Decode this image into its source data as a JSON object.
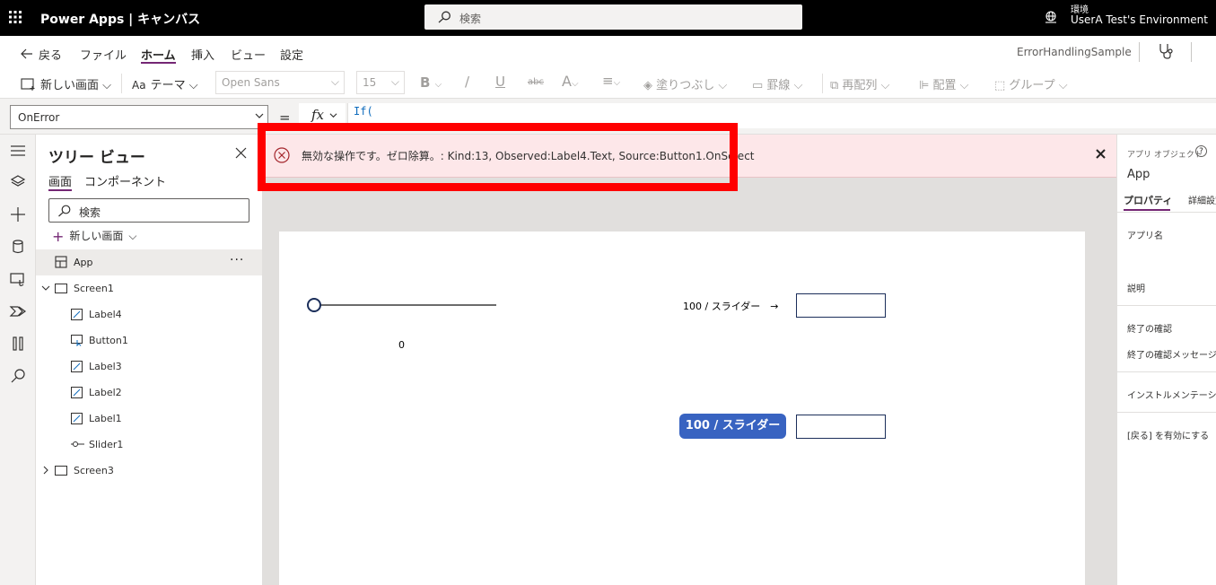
{
  "header": {
    "app_title": "Power Apps | キャンバス",
    "search_placeholder": "検索",
    "env_label": "環境",
    "env_name": "UserA Test's Environment"
  },
  "menu": {
    "back": "戻る",
    "file": "ファイル",
    "home": "ホーム",
    "insert": "挿入",
    "view": "ビュー",
    "settings": "設定",
    "app_name": "ErrorHandlingSample"
  },
  "toolbar": {
    "new_screen": "新しい画面",
    "theme": "テーマ",
    "font": "Open Sans",
    "font_size": "15",
    "bold": "B",
    "italic": "/",
    "underline": "U",
    "strike": "abc",
    "font_color": "A",
    "fill": "塗りつぶし",
    "border": "罫線",
    "reorder": "再配列",
    "align": "配置",
    "group": "グループ"
  },
  "formula": {
    "property": "OnError",
    "equals": "=",
    "fx": "fx",
    "text": "If("
  },
  "tree": {
    "title": "ツリー ビュー",
    "tab_screens": "画面",
    "tab_components": "コンポーネント",
    "search_placeholder": "検索",
    "new_screen": "新しい画面",
    "app": "App",
    "app_more": "···",
    "screen1": "Screen1",
    "children": [
      "Label4",
      "Button1",
      "Label3",
      "Label2",
      "Label1",
      "Slider1"
    ],
    "screen3": "Screen3"
  },
  "error": {
    "message": "無効な操作です。ゼロ除算。: Kind:13, Observed:Label4.Text, Source:Button1.OnSelect",
    "close": "×"
  },
  "canvas": {
    "slider_value": "0",
    "slider_level": 0,
    "label_top": "100 / スライダー　→",
    "button_text": "100 / スライダー"
  },
  "right_panel": {
    "header": "アプリ オブジェクト",
    "help": "?",
    "object_name": "App",
    "tab_properties": "プロパティ",
    "tab_advanced": "詳細設定",
    "app_name_label": "アプリ名",
    "description_label": "説明",
    "confirm_exit": "終了の確認",
    "confirm_exit_message": "終了の確認メッセージ",
    "instrumentation": "インストルメンテーション キー",
    "enable_back": "[戻る] を有効にする"
  },
  "colors": {
    "accent": "#742774",
    "error_bg": "#fde7e9",
    "error_icon": "#a4262c",
    "highlight": "#ff0000",
    "button": "#3863c1"
  }
}
